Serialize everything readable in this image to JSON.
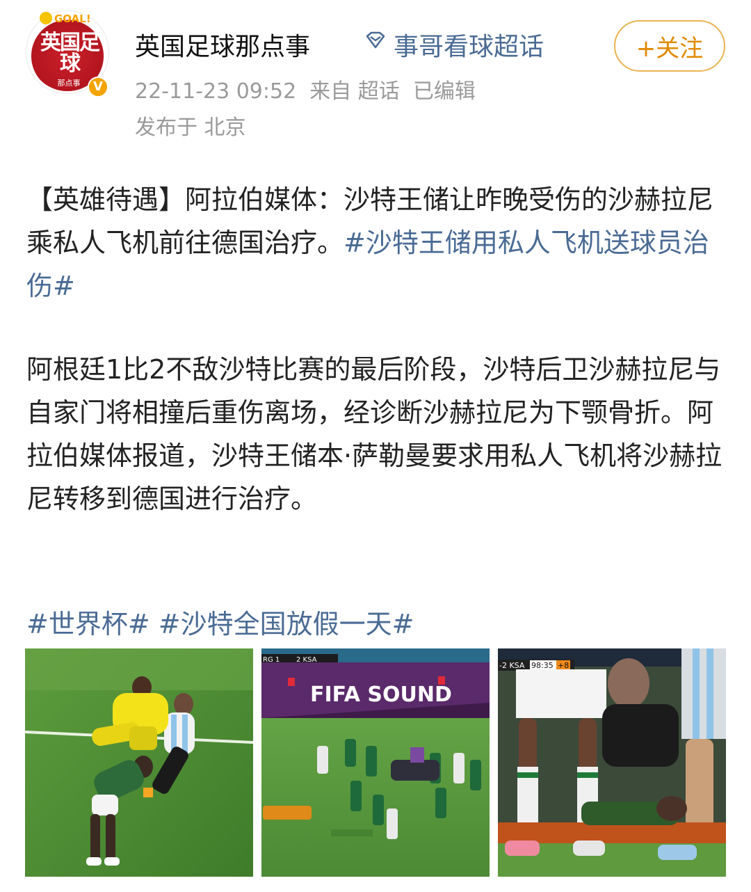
{
  "header": {
    "user_name": "英国足球那点事",
    "super_topic": "事哥看球超话",
    "follow_label": "+关注",
    "timestamp": "22-11-23 09:52",
    "source": "来自 超话",
    "edited": "已编辑",
    "location": "发布于 北京",
    "avatar_text": "英国足球",
    "avatar_sub": "那点事",
    "avatar_goal": "GOAL!"
  },
  "post": {
    "p1_text": "【英雄待遇】阿拉伯媒体：沙特王储让昨晚受伤的沙赫拉尼乘私人飞机前往德国治疗。",
    "p1_topic": "#沙特王储用私人飞机送球员治伤#",
    "p2_text": "阿根廷1比2不敌沙特比赛的最后阶段，沙特后卫沙赫拉尼与自家门将相撞后重伤离场，经诊断沙赫拉尼为下颚骨折。阿拉伯媒体报道，沙特王储本·萨勒曼要求用私人飞机将沙赫拉尼转移到德国进行治疗。",
    "topics": [
      "#世界杯#",
      "#沙特全国放假一天#"
    ]
  },
  "photos": {
    "p2_score_left": "RG 1",
    "p2_score_right": "2 KSA",
    "p2_banner": "FIFA SOUND",
    "p3_score": "-2 KSA",
    "p3_time": "98:35",
    "p3_added": "+8"
  },
  "colors": {
    "link": "#4a6b94",
    "follow": "#e08a00",
    "meta": "#9a9a9a"
  }
}
